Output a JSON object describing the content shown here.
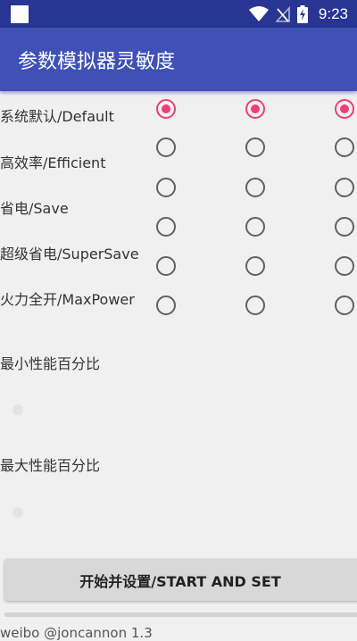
{
  "status_bar": {
    "time": "9:23",
    "icons": [
      "notification-square-icon",
      "wifi-icon",
      "no-signal-icon",
      "battery-charging-icon"
    ]
  },
  "app_bar": {
    "title": "参数模拟器灵敏度"
  },
  "modes": [
    {
      "label": "系统默认/Default",
      "selected": [
        true,
        true,
        true
      ]
    },
    {
      "label": "高效率/Efficient",
      "selected": [
        false,
        false,
        false
      ]
    },
    {
      "label": "省电/Save",
      "selected": [
        false,
        false,
        false
      ]
    },
    {
      "label": "超级省电/SuperSave",
      "selected": [
        false,
        false,
        false
      ]
    },
    {
      "label": "火力全开/MaxPower",
      "selected": [
        false,
        false,
        false
      ]
    }
  ],
  "min_perf": {
    "label": "最小性能百分比",
    "value": 0
  },
  "max_perf": {
    "label": "最大性能百分比",
    "value": 0
  },
  "start_button": {
    "label": "开始并设置/START AND SET"
  },
  "footer": {
    "text": "weibo @joncannon 1.3"
  },
  "colors": {
    "status_bar": "#283593",
    "app_bar": "#3f51b5",
    "accent": "#ec407a",
    "background": "#f0f0f0"
  }
}
